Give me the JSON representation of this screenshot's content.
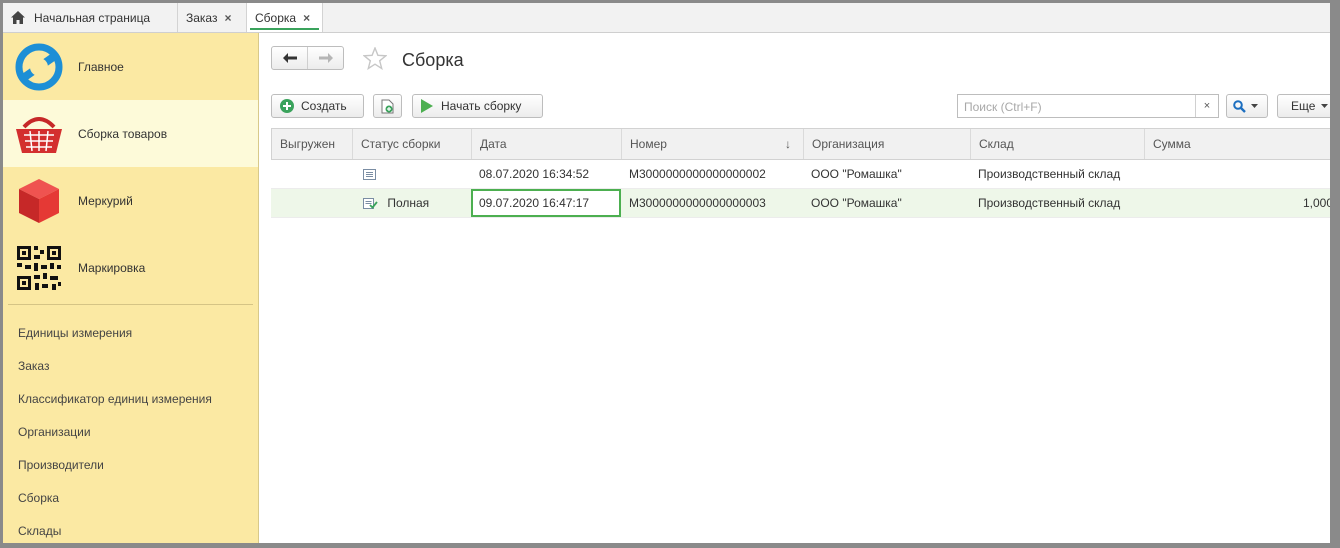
{
  "tabs": [
    {
      "label": "Начальная страница",
      "icon": "home-icon"
    },
    {
      "label": "Заказ",
      "close": "×"
    },
    {
      "label": "Сборка",
      "close": "×",
      "active": true
    }
  ],
  "sidebar": {
    "sections": [
      {
        "label": "Главное",
        "icon": "main-logo-icon"
      },
      {
        "label": "Сборка товаров",
        "icon": "basket-icon",
        "active": true
      },
      {
        "label": "Меркурий",
        "icon": "cube-icon"
      },
      {
        "label": "Маркировка",
        "icon": "qr-code-icon"
      }
    ],
    "items": [
      {
        "label": "Единицы измерения"
      },
      {
        "label": "Заказ"
      },
      {
        "label": "Классификатор единиц измерения"
      },
      {
        "label": "Организации"
      },
      {
        "label": "Производители"
      },
      {
        "label": "Сборка"
      },
      {
        "label": "Склады"
      }
    ]
  },
  "page": {
    "title": "Сборка"
  },
  "toolbar": {
    "create_label": "Создать",
    "start_label": "Начать сборку",
    "search_placeholder": "Поиск (Ctrl+F)",
    "clear_label": "×",
    "more_label": "Еще"
  },
  "table": {
    "columns": [
      "Выгружен",
      "Статус сборки",
      "Дата",
      "Номер",
      "Организация",
      "Склад",
      "Сумма"
    ],
    "sort_indicator": "↓",
    "rows": [
      {
        "exported": "",
        "status": "",
        "date": "08.07.2020 16:34:52",
        "number": "М3000000000000000002",
        "org": "ООО \"Ромашка\"",
        "warehouse": "Производственный склад",
        "sum": ""
      },
      {
        "exported": "",
        "status": "Полная",
        "date": "09.07.2020 16:47:17",
        "number": "М3000000000000000003",
        "org": "ООО \"Ромашка\"",
        "warehouse": "Производственный склад",
        "sum": "1,000"
      }
    ]
  },
  "colors": {
    "sidebar_bg": "#fbe9a3",
    "active_section_bg": "#fdfad9",
    "accent_green": "#4caf50",
    "selected_row": "#eef7e9"
  }
}
